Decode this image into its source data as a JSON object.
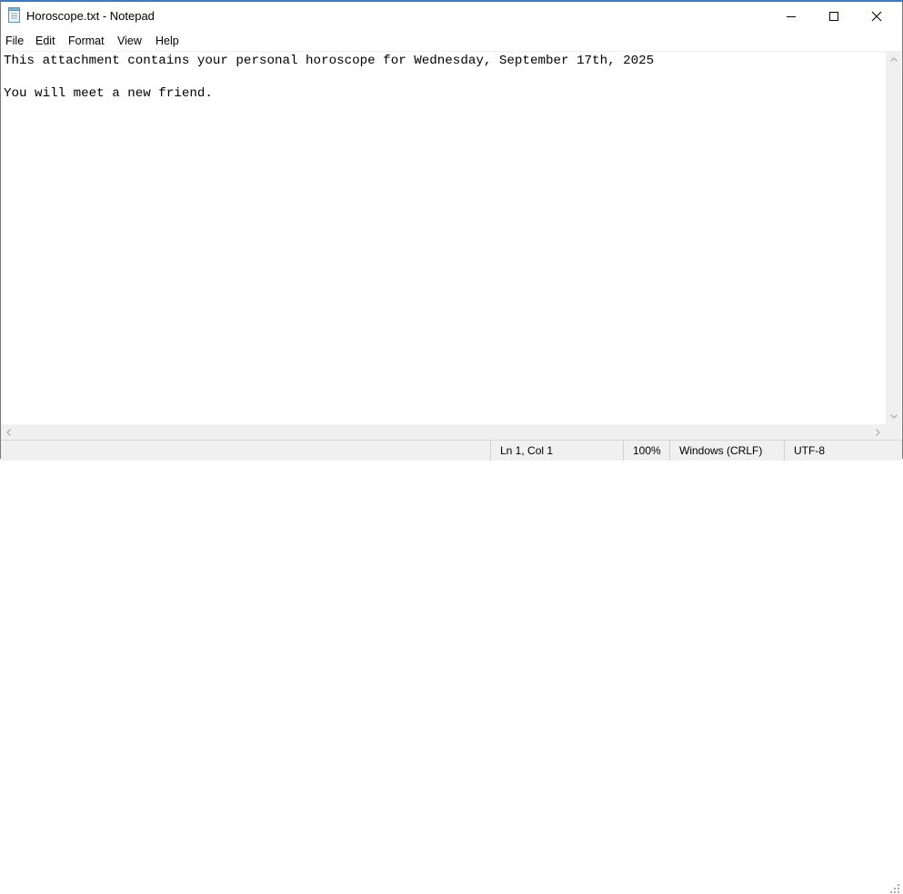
{
  "window": {
    "title": "Horoscope.txt - Notepad",
    "icon": "notepad-icon"
  },
  "controls": {
    "minimize_icon": "minimize-icon",
    "maximize_icon": "maximize-icon",
    "close_icon": "close-icon"
  },
  "menu": {
    "items": [
      "File",
      "Edit",
      "Format",
      "View",
      "Help"
    ]
  },
  "document": {
    "lines": [
      "This attachment contains your personal horoscope for Wednesday, September 17th, 2025",
      "",
      "You will meet a new friend."
    ]
  },
  "status": {
    "position": "Ln 1, Col 1",
    "zoom": "100%",
    "line_endings": "Windows (CRLF)",
    "encoding": "UTF-8"
  },
  "colors": {
    "title_accent": "#3c78c8",
    "chrome_gray": "#f0f0f0"
  }
}
